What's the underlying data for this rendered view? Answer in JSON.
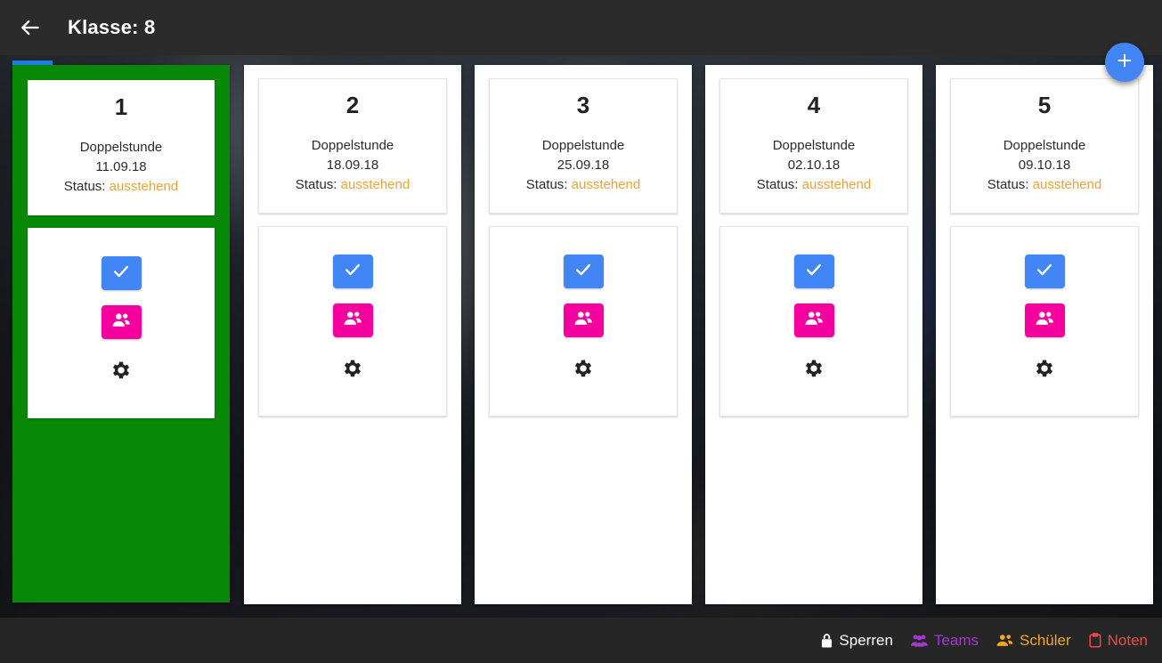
{
  "appbar": {
    "back_icon": "arrow-left-icon",
    "title": "Klasse: 8"
  },
  "fab": {
    "icon": "plus-icon",
    "label": "+"
  },
  "columns": [
    {
      "active": true,
      "number": "1",
      "type": "Doppelstunde",
      "date": "11.09.18",
      "status_label": "Status:",
      "status_value": "ausstehend",
      "actions": {
        "check_icon": "check-icon",
        "teams_icon": "people-icon",
        "settings_icon": "gear-icon"
      }
    },
    {
      "active": false,
      "number": "2",
      "type": "Doppelstunde",
      "date": "18.09.18",
      "status_label": "Status:",
      "status_value": "ausstehend",
      "actions": {
        "check_icon": "check-icon",
        "teams_icon": "people-icon",
        "settings_icon": "gear-icon"
      }
    },
    {
      "active": false,
      "number": "3",
      "type": "Doppelstunde",
      "date": "25.09.18",
      "status_label": "Status:",
      "status_value": "ausstehend",
      "actions": {
        "check_icon": "check-icon",
        "teams_icon": "people-icon",
        "settings_icon": "gear-icon"
      }
    },
    {
      "active": false,
      "number": "4",
      "type": "Doppelstunde",
      "date": "02.10.18",
      "status_label": "Status:",
      "status_value": "ausstehend",
      "actions": {
        "check_icon": "check-icon",
        "teams_icon": "people-icon",
        "settings_icon": "gear-icon"
      }
    },
    {
      "active": false,
      "number": "5",
      "type": "Doppelstunde",
      "date": "09.10.18",
      "status_label": "Status:",
      "status_value": "ausstehend",
      "actions": {
        "check_icon": "check-icon",
        "teams_icon": "people-icon",
        "settings_icon": "gear-icon"
      }
    }
  ],
  "bottombar": {
    "items": [
      {
        "label": "Sperren",
        "icon": "lock-icon",
        "color": "#ffffff"
      },
      {
        "label": "Teams",
        "icon": "people-icon",
        "color": "#a23ad1"
      },
      {
        "label": "Schüler",
        "icon": "students-icon",
        "color": "#f5a623"
      },
      {
        "label": "Noten",
        "icon": "clipboard-icon",
        "color": "#f0484f"
      }
    ]
  },
  "colors": {
    "appbar_bg": "#2b2b2b",
    "bottombar_bg": "#262626",
    "active_column": "#078907",
    "accent_blue": "#4285f4",
    "accent_magenta": "#f5009f",
    "status_orange": "#e8a33d",
    "progress_blue": "#1a7fe0"
  }
}
